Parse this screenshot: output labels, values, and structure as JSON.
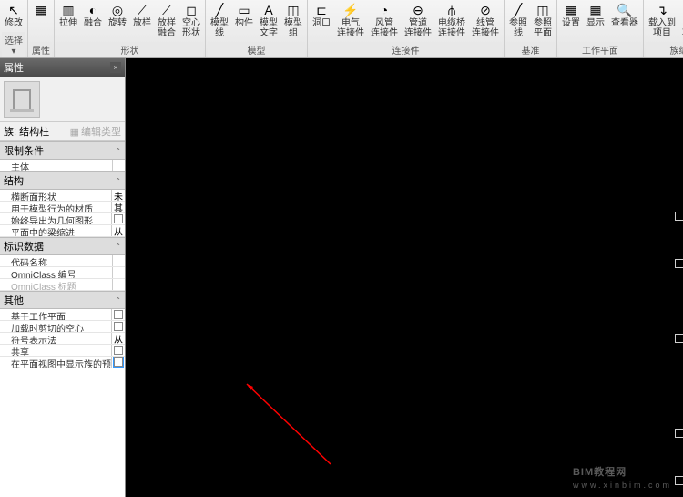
{
  "ribbon": {
    "groups": [
      {
        "label": "选择 ▾",
        "items": [
          {
            "icon": "↖",
            "name": "modify-cursor",
            "label": "修改"
          }
        ]
      },
      {
        "label": "属性",
        "items": [
          {
            "icon": "▦",
            "name": "properties-palette",
            "label": ""
          }
        ]
      },
      {
        "label": "形状",
        "items": [
          {
            "icon": "▥",
            "name": "extrude-icon",
            "label": "拉伸"
          },
          {
            "icon": "◐",
            "name": "blend-icon",
            "label": "融合"
          },
          {
            "icon": "◎",
            "name": "revolve-icon",
            "label": "旋转"
          },
          {
            "icon": "⟋",
            "name": "sweep-icon",
            "label": "放样"
          },
          {
            "icon": "⟋",
            "name": "sweep-blend-icon",
            "label": "放样\n融合"
          },
          {
            "icon": "◻",
            "name": "void-icon",
            "label": "空心\n形状"
          }
        ]
      },
      {
        "label": "模型",
        "items": [
          {
            "icon": "╱",
            "name": "model-line-icon",
            "label": "模型\n线"
          },
          {
            "icon": "▭",
            "name": "component-icon",
            "label": "构件"
          },
          {
            "icon": "A",
            "name": "model-text-icon",
            "label": "模型\n文字"
          },
          {
            "icon": "◫",
            "name": "model-group-icon",
            "label": "模型\n组"
          }
        ]
      },
      {
        "label": "连接件",
        "items": [
          {
            "icon": "⊏",
            "name": "opening-icon",
            "label": "洞口"
          },
          {
            "icon": "⚡",
            "name": "elec-conn-icon",
            "label": "电气\n连接件"
          },
          {
            "icon": "◔",
            "name": "duct-conn-icon",
            "label": "风管\n连接件"
          },
          {
            "icon": "⊖",
            "name": "pipe-conn-icon",
            "label": "管道\n连接件"
          },
          {
            "icon": "⫛",
            "name": "tray-conn-icon",
            "label": "电缆桥\n连接件"
          },
          {
            "icon": "⊘",
            "name": "conduit-conn-icon",
            "label": "线管\n连接件"
          }
        ]
      },
      {
        "label": "基准",
        "items": [
          {
            "icon": "╱",
            "name": "ref-line-icon",
            "label": "参照\n线"
          },
          {
            "icon": "◫",
            "name": "ref-plane-icon",
            "label": "参照\n平面"
          }
        ]
      },
      {
        "label": "工作平面",
        "items": [
          {
            "icon": "▦",
            "name": "set-wp-icon",
            "label": "设置"
          },
          {
            "icon": "▦",
            "name": "show-wp-icon",
            "label": "显示"
          },
          {
            "icon": "🔍",
            "name": "viewer-icon",
            "label": "查看器"
          }
        ]
      },
      {
        "label": "族编辑器",
        "items": [
          {
            "icon": "↴",
            "name": "load-proj-icon",
            "label": "载入到\n项目"
          },
          {
            "icon": "↴",
            "name": "load-close-icon",
            "label": "载入到\n项目并关闭"
          }
        ]
      }
    ]
  },
  "panel": {
    "title": "属性",
    "family": "族: 结构柱",
    "edit_type": "编辑类型",
    "categories": [
      {
        "name": "限制条件",
        "rows": [
          {
            "n": "主体",
            "v": ""
          }
        ]
      },
      {
        "name": "结构",
        "rows": [
          {
            "n": "横断面形状",
            "v": "未"
          },
          {
            "n": "用于模型行为的材质",
            "v": "其"
          },
          {
            "n": "始终导出为几何图形",
            "v": "chk"
          },
          {
            "n": "平面中的梁缩进",
            "v": "从"
          }
        ]
      },
      {
        "name": "标识数据",
        "rows": [
          {
            "n": "代码名称",
            "v": ""
          },
          {
            "n": "OmniClass 编号",
            "v": ""
          },
          {
            "n": "OmniClass 标题",
            "v": "",
            "disabled": true
          }
        ]
      },
      {
        "name": "其他",
        "rows": [
          {
            "n": "基于工作平面",
            "v": "chk"
          },
          {
            "n": "加载时剪切的空心",
            "v": "chk"
          },
          {
            "n": "符号表示法",
            "v": "从"
          },
          {
            "n": "共享",
            "v": "chk"
          },
          {
            "n": "在平面视图中显示族的预剪切",
            "v": "chk",
            "highlight": true
          }
        ]
      }
    ]
  },
  "watermark": {
    "main": "BIM教程网",
    "sub": "www.xinbim.com"
  }
}
